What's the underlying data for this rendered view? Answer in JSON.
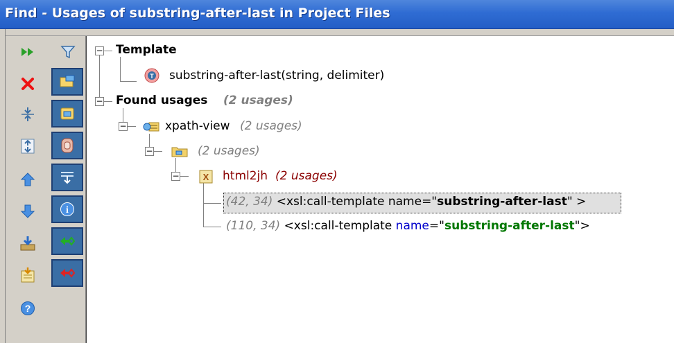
{
  "window": {
    "title": "Find - Usages of substring-after-last in Project Files"
  },
  "toolbar": {
    "left": [
      {
        "name": "rerun-icon",
        "tooltip": "Rerun"
      },
      {
        "name": "close-icon",
        "tooltip": "Close"
      },
      {
        "name": "collapse-all-icon",
        "tooltip": "Collapse All"
      },
      {
        "name": "expand-all-icon",
        "tooltip": "Expand All"
      },
      {
        "name": "previous-occurrence-icon",
        "tooltip": "Previous"
      },
      {
        "name": "next-occurrence-icon",
        "tooltip": "Next"
      },
      {
        "name": "export-icon",
        "tooltip": "Export"
      },
      {
        "name": "import-icon",
        "tooltip": "Import"
      },
      {
        "name": "help-icon",
        "tooltip": "Help"
      }
    ],
    "right": [
      {
        "name": "filter-icon"
      },
      {
        "name": "group-by-module-icon"
      },
      {
        "name": "group-by-directory-icon"
      },
      {
        "name": "group-by-file-icon"
      },
      {
        "name": "autoscroll-icon"
      },
      {
        "name": "info-icon"
      },
      {
        "name": "show-read-access-icon"
      },
      {
        "name": "show-write-access-icon"
      }
    ]
  },
  "tree": {
    "template_header": "Template",
    "template_item": "substring-after-last(string, delimiter)",
    "found_header": "Found usages",
    "found_count": "(2 usages)",
    "module_name": "xpath-view",
    "module_count": "(2 usages)",
    "dir_count": "(2 usages)",
    "file_name": "html2jh",
    "file_count": "(2 usages)",
    "usages": [
      {
        "pos": "(42, 34)",
        "tag_open": "<xsl:call-template name=\"",
        "name_value": "substring-after-last",
        "tag_close": "\" >"
      },
      {
        "pos": "(110, 34)",
        "tag_open": "<xsl:call-template",
        "attr": "name",
        "eq": "=\"",
        "name_value": "substring-after-last",
        "tag_close": "\">"
      }
    ]
  },
  "colors": {
    "title_bar": "#2f6cd3",
    "selected_button_bg": "#3a6ea5",
    "file_text": "#8b0000",
    "attr_name": "#0000cc",
    "attr_value": "#007700"
  }
}
